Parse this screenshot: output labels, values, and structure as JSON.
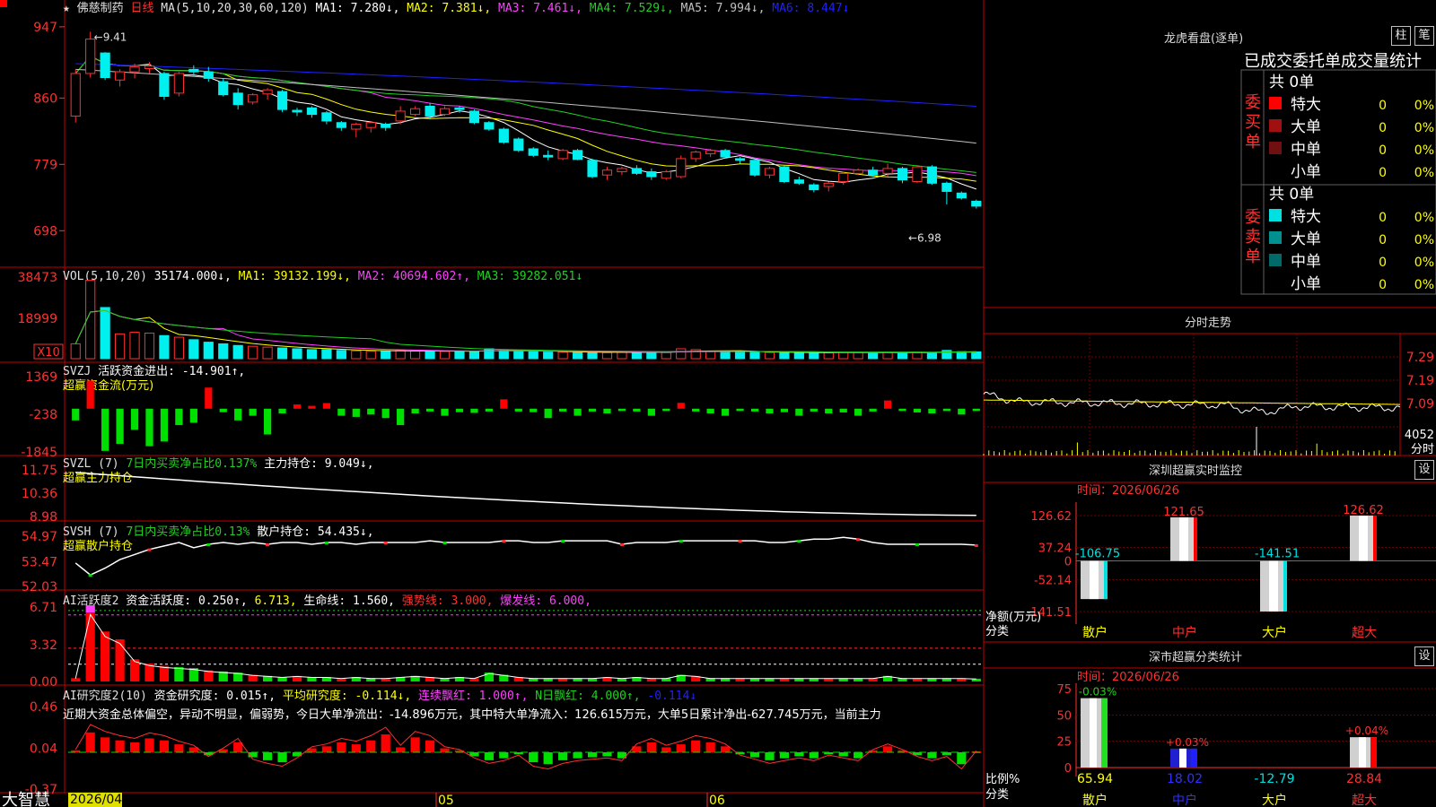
{
  "app": {
    "brand": "大智慧",
    "date_label": "2026/04"
  },
  "kline": {
    "header": [
      {
        "text": "★ 佛慈制药",
        "color": "#e0e0e0"
      },
      {
        "text": "日线",
        "color": "#ff3030"
      },
      {
        "text": "MA(5,10,20,30,60,120)",
        "color": "#e0e0e0"
      },
      {
        "text": "MA1: 7.280↓,",
        "color": "#ffffff"
      },
      {
        "text": "MA2: 7.381↓,",
        "color": "#ffff00"
      },
      {
        "text": "MA3: 7.461↓,",
        "color": "#ff40ff"
      },
      {
        "text": "MA4: 7.529↓,",
        "color": "#20d020"
      },
      {
        "text": "MA5: 7.994↓,",
        "color": "#c0c0c0"
      },
      {
        "text": "MA6: 8.447↓",
        "color": "#2020ff"
      }
    ],
    "yticks": [
      "947",
      "860",
      "779",
      "698"
    ],
    "ylim": [
      6.6,
      9.6
    ],
    "high_label": "9.41",
    "low_label": "6.98",
    "candles": [
      [
        8.38,
        8.95,
        8.3,
        8.9
      ],
      [
        8.9,
        9.41,
        8.85,
        9.32
      ],
      [
        9.15,
        9.16,
        8.82,
        8.85
      ],
      [
        8.82,
        8.95,
        8.74,
        8.92
      ],
      [
        8.92,
        9.02,
        8.84,
        8.98
      ],
      [
        8.96,
        9.04,
        8.9,
        8.99
      ],
      [
        8.9,
        8.92,
        8.58,
        8.62
      ],
      [
        8.66,
        8.92,
        8.62,
        8.9
      ],
      [
        8.95,
        9.0,
        8.86,
        8.92
      ],
      [
        8.92,
        8.98,
        8.8,
        8.84
      ],
      [
        8.8,
        8.84,
        8.62,
        8.64
      ],
      [
        8.66,
        8.72,
        8.46,
        8.52
      ],
      [
        8.55,
        8.66,
        8.52,
        8.64
      ],
      [
        8.65,
        8.72,
        8.58,
        8.7
      ],
      [
        8.68,
        8.7,
        8.43,
        8.46
      ],
      [
        8.45,
        8.48,
        8.38,
        8.43
      ],
      [
        8.48,
        8.5,
        8.36,
        8.4
      ],
      [
        8.42,
        8.44,
        8.28,
        8.32
      ],
      [
        8.3,
        8.32,
        8.2,
        8.24
      ],
      [
        8.22,
        8.3,
        8.12,
        8.28
      ],
      [
        8.24,
        8.32,
        8.18,
        8.3
      ],
      [
        8.28,
        8.3,
        8.2,
        8.24
      ],
      [
        8.32,
        8.5,
        8.28,
        8.44
      ],
      [
        8.4,
        8.5,
        8.38,
        8.47
      ],
      [
        8.5,
        8.54,
        8.34,
        8.38
      ],
      [
        8.4,
        8.5,
        8.38,
        8.47
      ],
      [
        8.48,
        8.5,
        8.42,
        8.46
      ],
      [
        8.44,
        8.46,
        8.28,
        8.3
      ],
      [
        8.3,
        8.32,
        8.2,
        8.22
      ],
      [
        8.22,
        8.24,
        8.04,
        8.06
      ],
      [
        8.1,
        8.12,
        7.94,
        7.96
      ],
      [
        7.98,
        8.0,
        7.88,
        7.9
      ],
      [
        7.9,
        7.96,
        7.84,
        7.88
      ],
      [
        7.86,
        7.98,
        7.84,
        7.96
      ],
      [
        7.96,
        7.98,
        7.84,
        7.85
      ],
      [
        7.84,
        7.86,
        7.62,
        7.64
      ],
      [
        7.66,
        7.76,
        7.6,
        7.72
      ],
      [
        7.7,
        7.76,
        7.66,
        7.74
      ],
      [
        7.74,
        7.78,
        7.66,
        7.68
      ],
      [
        7.7,
        7.74,
        7.6,
        7.64
      ],
      [
        7.62,
        7.72,
        7.6,
        7.7
      ],
      [
        7.64,
        7.9,
        7.62,
        7.86
      ],
      [
        7.86,
        7.96,
        7.82,
        7.94
      ],
      [
        7.92,
        7.98,
        7.88,
        7.96
      ],
      [
        7.96,
        7.98,
        7.86,
        7.88
      ],
      [
        7.86,
        7.88,
        7.8,
        7.84
      ],
      [
        7.84,
        7.86,
        7.64,
        7.66
      ],
      [
        7.66,
        7.76,
        7.62,
        7.74
      ],
      [
        7.76,
        7.78,
        7.56,
        7.58
      ],
      [
        7.6,
        7.64,
        7.54,
        7.56
      ],
      [
        7.54,
        7.56,
        7.45,
        7.48
      ],
      [
        7.52,
        7.58,
        7.46,
        7.56
      ],
      [
        7.58,
        7.7,
        7.54,
        7.68
      ],
      [
        7.68,
        7.74,
        7.66,
        7.72
      ],
      [
        7.72,
        7.76,
        7.64,
        7.66
      ],
      [
        7.68,
        7.8,
        7.64,
        7.74
      ],
      [
        7.74,
        7.76,
        7.56,
        7.6
      ],
      [
        7.58,
        7.78,
        7.56,
        7.76
      ],
      [
        7.76,
        7.78,
        7.54,
        7.56
      ],
      [
        7.56,
        7.58,
        7.3,
        7.46
      ],
      [
        7.44,
        7.46,
        7.36,
        7.38
      ],
      [
        7.34,
        7.36,
        7.25,
        7.28
      ]
    ]
  },
  "volume": {
    "header": [
      {
        "text": "VOL(5,10,20)",
        "color": "#e0e0e0"
      },
      {
        "text": "35174.000↓,",
        "color": "#ffffff"
      },
      {
        "text": "MA1: 39132.199↓,",
        "color": "#ffff00"
      },
      {
        "text": "MA2: 40694.602↑,",
        "color": "#ff40ff"
      },
      {
        "text": "MA3: 39282.051↓",
        "color": "#20d020"
      }
    ],
    "yticks": [
      "38473",
      "18999"
    ],
    "unit": "X10",
    "values": [
      1800,
      9500,
      6200,
      3000,
      3200,
      3100,
      2800,
      2600,
      2300,
      2000,
      1800,
      1600,
      1500,
      1400,
      1300,
      1200,
      1100,
      1100,
      1000,
      950,
      900,
      900,
      1000,
      950,
      900,
      880,
      850,
      900,
      1200,
      1000,
      900,
      850,
      800,
      800,
      780,
      760,
      740,
      760,
      780,
      760,
      740,
      1200,
      1100,
      900,
      850,
      800,
      780,
      760,
      740,
      720,
      700,
      720,
      760,
      740,
      720,
      760,
      720,
      780,
      720,
      1000,
      850,
      820
    ]
  },
  "svzj": {
    "header": [
      {
        "text": "SVZJ",
        "color": "#e0e0e0"
      },
      {
        "text": "活跃资金进出: -14.901↑,",
        "color": "#ffffff"
      },
      {
        "text": "超赢资金流(万元)",
        "color": "#ffff00"
      }
    ],
    "yticks": [
      "1369",
      "-238",
      "-1845"
    ],
    "values": [
      -500,
      1200,
      -1800,
      -1500,
      -900,
      -1600,
      -1400,
      -700,
      -600,
      900,
      -150,
      -500,
      -300,
      -1100,
      -200,
      180,
      120,
      240,
      -300,
      -350,
      -250,
      -400,
      -700,
      -200,
      -120,
      -300,
      -150,
      -180,
      -120,
      400,
      -120,
      -150,
      -400,
      -120,
      -300,
      -120,
      -200,
      -100,
      -120,
      -300,
      -100,
      250,
      -120,
      -200,
      -300,
      -100,
      -120,
      -200,
      -150,
      -300,
      -120,
      -200,
      -160,
      -300,
      -120,
      350,
      -100,
      -160,
      -200,
      -100,
      -250,
      -100
    ]
  },
  "svzl": {
    "header": [
      {
        "text": "SVZL (7)",
        "color": "#e0e0e0"
      },
      {
        "text": "7日内买卖净占比0.137%",
        "color": "#20d020"
      },
      {
        "text": "主力持仓: 9.049↓,",
        "color": "#ffffff"
      },
      {
        "text": "超赢主力持仓",
        "color": "#ffff00"
      }
    ],
    "yticks": [
      "11.75",
      "10.36",
      "8.98"
    ],
    "start": 11.6,
    "end": 9.05
  },
  "svsh": {
    "header": [
      {
        "text": "SVSH (7)",
        "color": "#e0e0e0"
      },
      {
        "text": "7日内买卖净占比0.13%",
        "color": "#20d020"
      },
      {
        "text": "散户持仓: 54.435↓,",
        "color": "#ffffff"
      },
      {
        "text": "超赢散户持仓",
        "color": "#ffff00"
      }
    ],
    "yticks": [
      "54.97",
      "53.47",
      "52.03"
    ],
    "values": [
      53.4,
      52.7,
      53.1,
      53.6,
      53.9,
      54.2,
      54.4,
      54.6,
      54.3,
      54.5,
      54.6,
      54.5,
      54.6,
      54.5,
      54.6,
      54.6,
      54.5,
      54.6,
      54.6,
      54.5,
      54.6,
      54.6,
      54.6,
      54.6,
      54.7,
      54.6,
      54.6,
      54.6,
      54.6,
      54.7,
      54.7,
      54.6,
      54.6,
      54.7,
      54.7,
      54.7,
      54.7,
      54.5,
      54.6,
      54.6,
      54.6,
      54.7,
      54.7,
      54.7,
      54.7,
      54.7,
      54.7,
      54.6,
      54.6,
      54.7,
      54.8,
      54.8,
      54.9,
      54.8,
      54.6,
      54.5,
      54.5,
      54.5,
      54.5,
      54.5,
      54.5,
      54.45
    ]
  },
  "ai_active": {
    "header": [
      {
        "text": "AI活跃度2",
        "color": "#e0e0e0"
      },
      {
        "text": "资金活跃度: 0.250↑,",
        "color": "#ffffff"
      },
      {
        "text": "6.713,",
        "color": "#ffff00"
      },
      {
        "text": "生命线: 1.560,",
        "color": "#ffffff"
      },
      {
        "text": "强势线: 3.000,",
        "color": "#ff3030"
      },
      {
        "text": "爆发线: 6.000,",
        "color": "#ff40ff"
      }
    ],
    "yticks": [
      "6.71",
      "3.32",
      "0.00"
    ],
    "values": [
      0.3,
      6.7,
      4.5,
      3.8,
      2.0,
      1.6,
      1.4,
      1.3,
      1.2,
      1.0,
      0.9,
      0.8,
      0.6,
      0.5,
      0.4,
      0.5,
      0.4,
      0.4,
      0.3,
      0.4,
      0.3,
      0.3,
      0.4,
      0.5,
      0.4,
      0.3,
      0.4,
      0.3,
      0.8,
      0.6,
      0.4,
      0.3,
      0.3,
      0.3,
      0.3,
      0.3,
      0.4,
      0.3,
      0.4,
      0.3,
      0.3,
      0.6,
      0.5,
      0.3,
      0.3,
      0.3,
      0.3,
      0.3,
      0.3,
      0.3,
      0.3,
      0.3,
      0.3,
      0.3,
      0.3,
      0.5,
      0.3,
      0.3,
      0.3,
      0.3,
      0.3,
      0.25
    ]
  },
  "ai_research": {
    "header": [
      {
        "text": "AI研究度2(10)",
        "color": "#e0e0e0"
      },
      {
        "text": "资金研究度: 0.015↑,",
        "color": "#ffffff"
      },
      {
        "text": "平均研究度: -0.114↓,",
        "color": "#ffff00"
      },
      {
        "text": "连续飘红: 1.000↑,",
        "color": "#ff40ff"
      },
      {
        "text": "N日飘红: 4.000↑,",
        "color": "#20d020"
      },
      {
        "text": "-0.114↓",
        "color": "#2020ff"
      }
    ],
    "comment": "近期大资金总体偏空，异动不明显，偏弱势，今日大单净流出：-14.896万元，其中特大单净流入：126.615万元，大单5日累计净出-627.745万元，当前主力",
    "yticks": [
      "0.46",
      "0.04",
      "-0.37"
    ],
    "values": [
      0.02,
      0.2,
      0.15,
      0.12,
      0.1,
      0.14,
      0.12,
      0.08,
      0.05,
      -0.03,
      0.03,
      0.1,
      -0.05,
      -0.08,
      -0.1,
      -0.04,
      0.04,
      0.06,
      0.1,
      0.08,
      0.12,
      0.18,
      0.05,
      0.15,
      0.12,
      0.04,
      0.02,
      -0.04,
      -0.08,
      -0.06,
      -0.02,
      -0.1,
      -0.12,
      -0.08,
      -0.06,
      -0.05,
      -0.04,
      -0.06,
      0.06,
      0.1,
      0.05,
      0.08,
      0.12,
      0.1,
      0.06,
      -0.02,
      -0.05,
      -0.08,
      -0.06,
      -0.04,
      -0.06,
      -0.02,
      -0.04,
      -0.06,
      0.02,
      0.06,
      0.02,
      -0.03,
      -0.06,
      -0.03,
      -0.12,
      0.01
    ]
  },
  "xaxis": {
    "labels": [
      "05",
      "06"
    ]
  },
  "dragon": {
    "title": "龙虎看盘(逐单)",
    "btn1": "柱",
    "btn2": "笔",
    "subtitle": "已成交委托单成交量统计",
    "buy_label": "委买单",
    "sell_label": "委卖单",
    "buy_total": "共 0单",
    "sell_total": "共 0单",
    "buy_rows": [
      {
        "name": "特大",
        "count": "0",
        "pct": "0%",
        "color": "#ff0000"
      },
      {
        "name": "大单",
        "count": "0",
        "pct": "0%",
        "color": "#a01010"
      },
      {
        "name": "中单",
        "count": "0",
        "pct": "0%",
        "color": "#701010"
      },
      {
        "name": "小单",
        "count": "0",
        "pct": "0%",
        "color": "#000000"
      }
    ],
    "sell_rows": [
      {
        "name": "特大",
        "count": "0",
        "pct": "0%",
        "color": "#00e0e0"
      },
      {
        "name": "大单",
        "count": "0",
        "pct": "0%",
        "color": "#009090"
      },
      {
        "name": "中单",
        "count": "0",
        "pct": "0%",
        "color": "#006a6a"
      },
      {
        "name": "小单",
        "count": "0",
        "pct": "0%",
        "color": "#000000"
      }
    ]
  },
  "minute": {
    "title": "分时走势",
    "yticks": [
      "7.29",
      "7.19",
      "7.09"
    ],
    "vol_tick": "4052",
    "vol_unit": "分时"
  },
  "monitor": {
    "title": "深圳超赢实时监控",
    "btn": "设",
    "time_label": "时间：2026/06/26",
    "yticks": [
      "126.62",
      "37.24",
      "0",
      "-52.14",
      "-141.51"
    ],
    "bars": [
      {
        "name": "散户",
        "value": -106.75,
        "label": "-106.75",
        "name_color": "#ffff00"
      },
      {
        "name": "中户",
        "value": 121.65,
        "label": "121.65",
        "name_color": "#ff3030"
      },
      {
        "name": "大户",
        "value": -141.51,
        "label": "-141.51",
        "name_color": "#ffff00"
      },
      {
        "name": "超大",
        "value": 126.62,
        "label": "126.62",
        "name_color": "#ff3030"
      }
    ],
    "axis_label1": "净额(万元)",
    "axis_label2": "分类"
  },
  "classify": {
    "title": "深市超赢分类统计",
    "btn": "设",
    "time_label": "时间：2026/06/26",
    "yticks": [
      "75",
      "50",
      "25",
      "0"
    ],
    "bars": [
      {
        "name": "散户",
        "value": 65.94,
        "label": "65.94",
        "pct_label": "-0.03%",
        "name_color": "#ffff00",
        "value_color": "#ffff00",
        "pct_color": "#20d020"
      },
      {
        "name": "中户",
        "value": 18.02,
        "label": "18.02",
        "pct_label": "+0.03%",
        "name_color": "#3030ff",
        "value_color": "#3030ff",
        "pct_color": "#ff3030"
      },
      {
        "name": "大户",
        "value": -12.79,
        "label": "-12.79",
        "pct_label": "",
        "name_color": "#ffff00",
        "value_color": "#00e0e0",
        "pct_color": "#ff3030"
      },
      {
        "name": "超大",
        "value": 28.84,
        "label": "28.84",
        "pct_label": "+0.04%",
        "name_color": "#ff3030",
        "value_color": "#ff3030",
        "pct_color": "#ff3030"
      }
    ],
    "axis_label1": "比例%",
    "axis_label2": "分类"
  }
}
